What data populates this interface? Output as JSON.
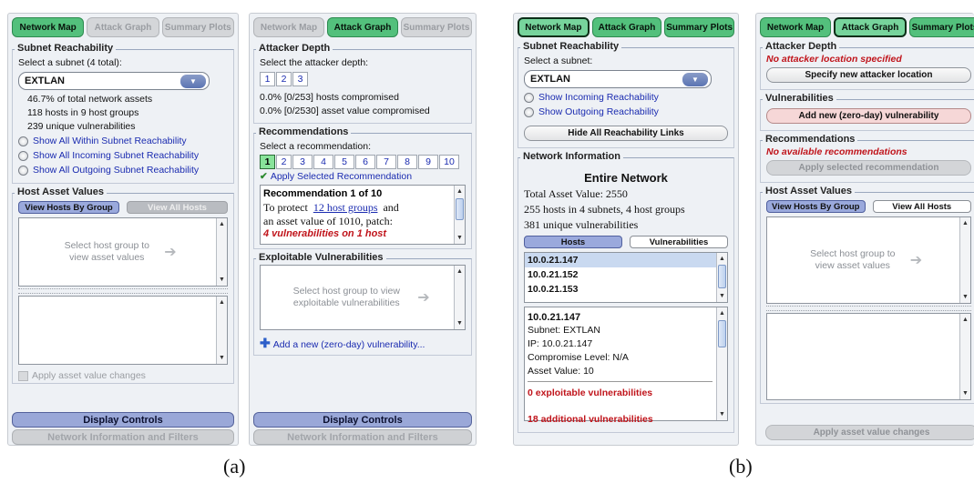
{
  "captions": {
    "a": "(a)",
    "b": "(b)"
  },
  "tabs": {
    "network_map": "Network Map",
    "attack_graph": "Attack Graph",
    "summary_plots": "Summary Plots"
  },
  "panel1": {
    "subnet_reach_title": "Subnet Reachability",
    "select_label": "Select a subnet (4 total):",
    "selected_subnet": "EXTLAN",
    "stat1": "46.7% of total network assets",
    "stat2": "118 hosts in 9 host groups",
    "stat3": "239 unique vulnerabilities",
    "radios": [
      "Show All Within Subnet Reachability",
      "Show All Incoming Subnet Reachability",
      "Show All Outgoing Subnet Reachability"
    ],
    "host_asset_title": "Host Asset Values",
    "view_by_group": "View Hosts By Group",
    "view_all": "View All Hosts",
    "placeholder": "Select host group to view asset values",
    "apply_changes": "Apply asset value changes",
    "display_controls": "Display Controls",
    "net_info_filters": "Network Information and Filters"
  },
  "panel2": {
    "attacker_depth_title": "Attacker Depth",
    "depth_label": "Select the attacker depth:",
    "depths": [
      "1",
      "2",
      "3"
    ],
    "hosts_compromised": "0.0% [0/253] hosts compromised",
    "asset_compromised": "0.0% [0/2530] asset value compromised",
    "recs_title": "Recommendations",
    "rec_label": "Select a recommendation:",
    "rec_numbers": [
      "1",
      "2",
      "3",
      "4",
      "5",
      "6",
      "7",
      "8",
      "9",
      "10"
    ],
    "apply_selected": "Apply Selected Recommendation",
    "rec_heading": "Recommendation 1 of 10",
    "rec_text1": "To protect",
    "rec_link": "12 host groups",
    "rec_text2": "and",
    "rec_text3": "an asset value of 1010, patch:",
    "rec_vulns": "4 vulnerabilities on 1 host",
    "exploitable_title": "Exploitable Vulnerabilities",
    "placeholder": "Select host group to view exploitable vulnerabilities",
    "add_vuln": "Add a new (zero-day) vulnerability...",
    "display_controls": "Display Controls",
    "net_info_filters": "Network Information and Filters"
  },
  "panel3": {
    "subnet_reach_title": "Subnet Reachability",
    "select_label": "Select a subnet:",
    "selected_subnet": "EXTLAN",
    "radios": [
      "Show Incoming Reachability",
      "Show Outgoing Reachability"
    ],
    "hide_links": "Hide All Reachability Links",
    "net_info_title": "Network Information",
    "entire_network": "Entire Network",
    "total_asset": "Total Asset Value: 2550",
    "hosts_subnets": "255 hosts in 4 subnets, 4 host groups",
    "unique_vulns": "381 unique vulnerabilities",
    "hosts_tab": "Hosts",
    "vulns_tab": "Vulnerabilities",
    "hosts": [
      "10.0.21.147",
      "10.0.21.152",
      "10.0.21.153"
    ],
    "detail_ip_title": "10.0.21.147",
    "detail_subnet": "Subnet: EXTLAN",
    "detail_ip": "IP: 10.0.21.147",
    "detail_compromise": "Compromise Level: N/A",
    "detail_asset": "Asset Value: 10",
    "exploitable": "0 exploitable vulnerabilities",
    "additional": "18 additional vulnerabilities"
  },
  "panel4": {
    "attacker_depth_title": "Attacker Depth",
    "no_location": "No attacker location specified",
    "specify_location": "Specify new attacker location",
    "vulns_title": "Vulnerabilities",
    "add_vuln": "Add new (zero-day) vulnerability",
    "recs_title": "Recommendations",
    "no_recs": "No available recommendations",
    "apply_rec": "Apply selected recommendation",
    "host_asset_title": "Host Asset Values",
    "view_by_group": "View Hosts By Group",
    "view_all": "View All Hosts",
    "placeholder": "Select host group to view asset values",
    "apply_changes": "Apply asset value changes"
  }
}
